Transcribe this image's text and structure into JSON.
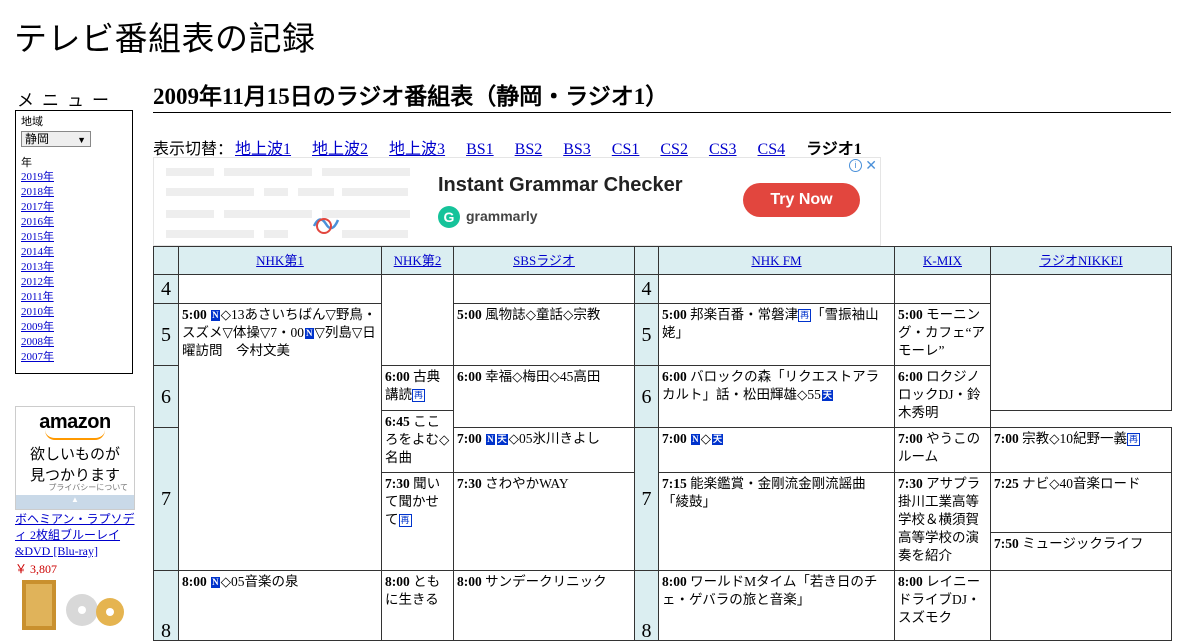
{
  "site_title": "テレビ番組表の記録",
  "menu": {
    "title": "メニュー",
    "region_label": "地域",
    "region_value": "静岡",
    "year_label": "年",
    "years": [
      "2019年",
      "2018年",
      "2017年",
      "2016年",
      "2015年",
      "2014年",
      "2013年",
      "2012年",
      "2011年",
      "2010年",
      "2009年",
      "2008年",
      "2007年"
    ]
  },
  "amazon_ad": {
    "logo": "amazon",
    "tagline_1": "欲しいものが",
    "tagline_2": "見つかります",
    "privacy": "プライバシーについて",
    "product": "ボヘミアン・ラプソディ 2枚組ブルーレイ&DVD [Blu-ray]",
    "price": "￥ 3,807"
  },
  "page_heading": "2009年11月15日のラジオ番組表（静岡・ラジオ1）",
  "switcher": {
    "label": "表示切替：",
    "links": [
      "地上波1",
      "地上波2",
      "地上波3",
      "BS1",
      "BS2",
      "BS3",
      "CS1",
      "CS2",
      "CS3",
      "CS4"
    ],
    "current": "ラジオ1"
  },
  "banner_ad": {
    "headline": "Instant Grammar Checker",
    "brand": "grammarly",
    "cta": "Try Now",
    "info": "i",
    "close": "✕"
  },
  "schedule": {
    "channels": [
      "NHK第1",
      "NHK第2",
      "SBSラジオ",
      "NHK FM",
      "K-MIX",
      "ラジオNIKKEI"
    ],
    "hours": [
      "4",
      "5",
      "6",
      "7",
      "8"
    ],
    "programs": {
      "nhk1_500_time": "5:00",
      "nhk1_500_a": "◇13あさいちばん▽野鳥・スズメ▽体操▽7・00",
      "nhk1_500_b": "▽列島▽日曜訪問　今村文美",
      "nhk1_800_time": "8:00",
      "nhk1_800": "◇05音楽の泉",
      "nhk2_600_time": "6:00",
      "nhk2_600": "古典講読",
      "nhk2_645_time": "6:45",
      "nhk2_645": "こころをよむ◇名曲",
      "nhk2_730_time": "7:30",
      "nhk2_730": "聞いて聞かせて",
      "nhk2_800_time": "8:00",
      "nhk2_800": "ともに生きる",
      "sbs_500_time": "5:00",
      "sbs_500": "風物誌◇童話◇宗教",
      "sbs_600_time": "6:00",
      "sbs_600": "幸福◇梅田◇45高田",
      "sbs_700_time": "7:00",
      "sbs_700": "◇05氷川きよし",
      "sbs_730_time": "7:30",
      "sbs_730": "さわやかWAY",
      "sbs_800_time": "8:00",
      "sbs_800": "サンデークリニック",
      "fm_500_time": "5:00",
      "fm_500": "邦楽百番・常磐津",
      "fm_500_b": "「雪振袖山姥」",
      "fm_600_time": "6:00",
      "fm_600": "バロックの森「リクエストアラカルト」話・松田輝雄◇55",
      "fm_700_time": "7:00",
      "fm_715_time": "7:15",
      "fm_715": "能楽鑑賞・金剛流金剛流謡曲「綾鼓」",
      "fm_800_time": "8:00",
      "fm_800": "ワールドMタイム「若き日のチェ・ゲバラの旅と音楽」",
      "kmix_500_time": "5:00",
      "kmix_500": "モーニング・カフェ“アモーレ”",
      "kmix_600_time": "6:00",
      "kmix_600": "ロクジノロックDJ・鈴木秀明",
      "kmix_700_time": "7:00",
      "kmix_700": "やうこのルーム",
      "kmix_730_time": "7:30",
      "kmix_730": "アサプラ掛川工業高等学校＆横須賀高等学校の演奏を紹介",
      "kmix_800_time": "8:00",
      "kmix_800": "レイニードライブDJ・スズモク",
      "nikkei_700_time": "7:00",
      "nikkei_700": "宗教◇10紀野一義",
      "nikkei_725_time": "7:25",
      "nikkei_725": "ナビ◇40音楽ロード",
      "nikkei_750_time": "7:50",
      "nikkei_750": "ミュージックライフ"
    },
    "marks": {
      "news": "N",
      "ten": "天",
      "re": "再"
    }
  }
}
